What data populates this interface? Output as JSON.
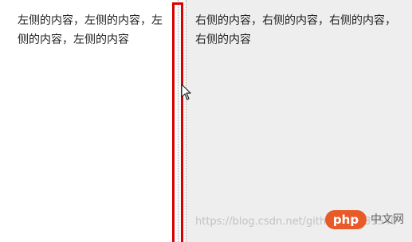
{
  "left_panel": {
    "text": "左侧的内容，左侧的内容，左侧的内容，左侧的内容"
  },
  "right_panel": {
    "text": "右侧的内容，右侧的内容，右侧的内容，右侧的内容"
  },
  "watermark": {
    "url": "https://blog.csdn.net/github_35631540",
    "logo_text": "php",
    "site_name": "中文网"
  },
  "colors": {
    "highlight": "#d90000",
    "right_bg": "#eeeeee",
    "left_bg": "#ffffff",
    "logo": "#e85a27"
  }
}
